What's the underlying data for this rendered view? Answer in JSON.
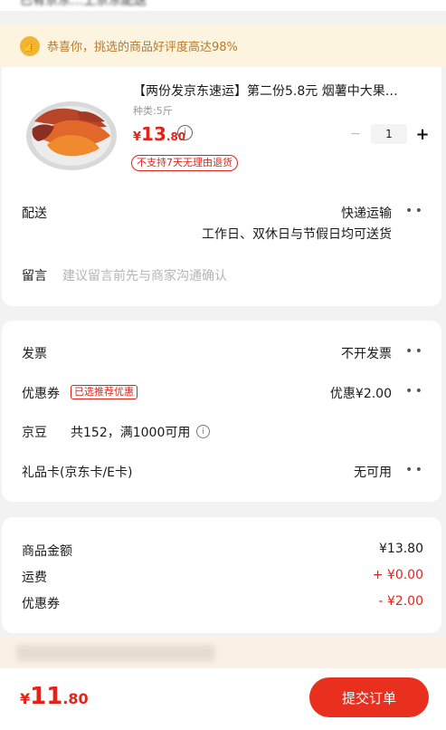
{
  "top_bar": {
    "text": "已有京东…上京东配送"
  },
  "banner": {
    "icon": "thumbs-up-icon",
    "text": "恭喜你，挑选的商品好评度高达98%"
  },
  "product": {
    "title": "【两份发京东速运】第二份5.8元 烟薯中大果…",
    "spec": "种类:5斤",
    "price_symbol": "¥",
    "price_int": "13",
    "price_dec": ".80",
    "quantity": "1",
    "minus": "−",
    "plus": "+",
    "return_policy": "不支持7天无理由退货"
  },
  "delivery": {
    "label": "配送",
    "method": "快递运输",
    "note": "工作日、双休日与节假日均可送货"
  },
  "message": {
    "label": "留言",
    "placeholder": "建议留言前先与商家沟通确认"
  },
  "invoice": {
    "label": "发票",
    "value": "不开发票"
  },
  "coupon": {
    "label": "优惠券",
    "badge": "已选推荐优惠",
    "value": "优惠¥2.00"
  },
  "jd_beans": {
    "label": "京豆",
    "detail": "共152，满1000可用"
  },
  "gift_card": {
    "label": "礼品卡(京东卡/E卡)",
    "value": "无可用"
  },
  "summary": {
    "goods_label": "商品金额",
    "goods_value": "¥13.80",
    "shipping_label": "运费",
    "shipping_value": "+ ¥0.00",
    "coupon_label": "优惠券",
    "coupon_value": "- ¥2.00"
  },
  "footer": {
    "total_symbol": "¥",
    "total_int": "11",
    "total_dec": ".80",
    "submit_label": "提交订单"
  },
  "colors": {
    "accent": "#e2231a",
    "submit": "#e9301f",
    "banner_bg": "#fdf4e0",
    "banner_text": "#b7792a"
  }
}
